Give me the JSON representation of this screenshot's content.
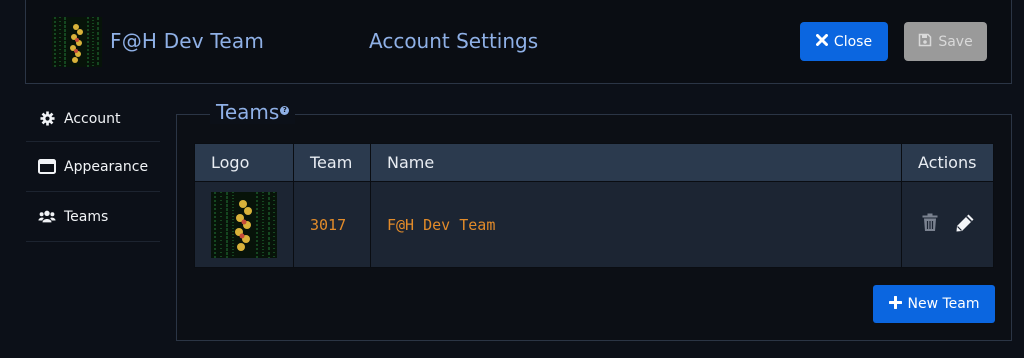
{
  "header": {
    "team_name": "F@H Dev Team",
    "title": "Account Settings",
    "close_label": "Close",
    "save_label": "Save"
  },
  "sidebar": {
    "items": [
      {
        "label": "Account",
        "icon": "gear-icon"
      },
      {
        "label": "Appearance",
        "icon": "window-icon"
      },
      {
        "label": "Teams",
        "icon": "users-icon"
      }
    ]
  },
  "teams_panel": {
    "legend": "Teams",
    "columns": [
      "Logo",
      "Team",
      "Name",
      "Actions"
    ],
    "rows": [
      {
        "team": "3017",
        "name": "F@H Dev Team"
      }
    ],
    "new_team_label": "New Team"
  },
  "colors": {
    "accent": "#0b66e0",
    "heading": "#8fb0e6",
    "mono_text": "#e28b2a",
    "table_header": "#2b3a4e",
    "table_row": "#1c2533"
  }
}
